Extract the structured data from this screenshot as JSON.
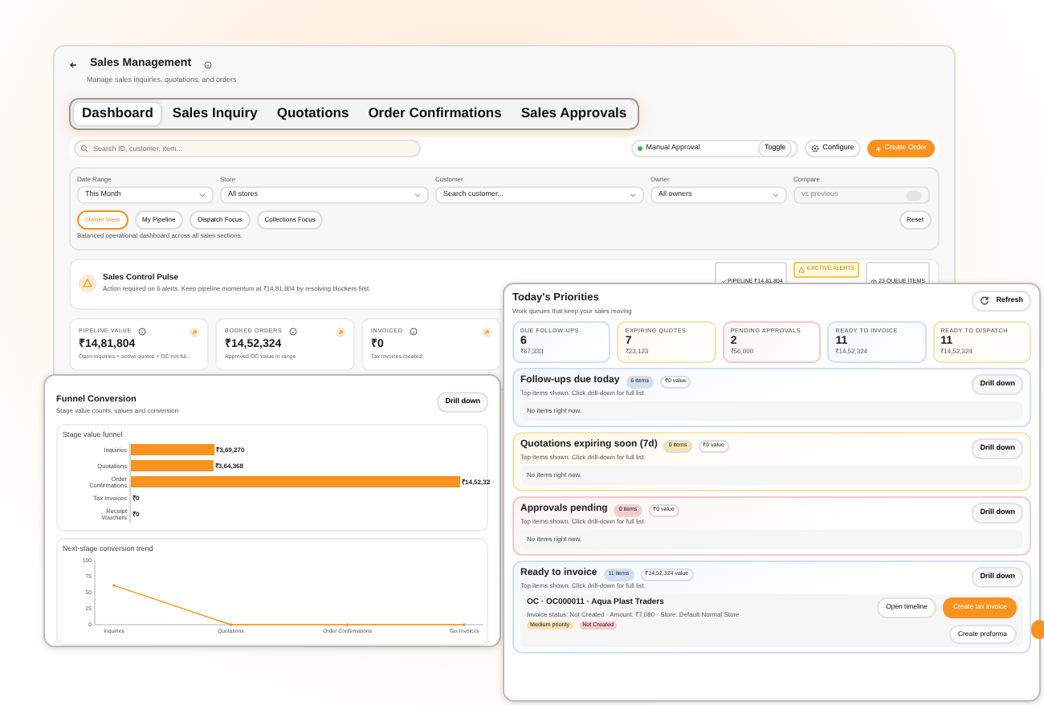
{
  "header": {
    "title": "Sales Management",
    "subtitle": "Manage sales inquiries, quotations, and orders"
  },
  "tabs": [
    {
      "label": "Dashboard",
      "selected": true
    },
    {
      "label": "Sales Inquiry",
      "selected": false
    },
    {
      "label": "Quotations",
      "selected": false
    },
    {
      "label": "Order Confirmations",
      "selected": false
    },
    {
      "label": "Sales Approvals",
      "selected": false
    }
  ],
  "toolbar": {
    "search": {
      "placeholder": "Search ID, customer, item..."
    },
    "approval": {
      "label": "Manual Approval",
      "on": true,
      "toggle": "Toggle"
    },
    "configure": "Configure",
    "create": "Create Order"
  },
  "filters": [
    {
      "label": "Date Range",
      "value": "This Month",
      "kind": "select"
    },
    {
      "label": "Store",
      "value": "All stores",
      "kind": "select"
    },
    {
      "label": "Customer",
      "value": "Search customer...",
      "kind": "select"
    },
    {
      "label": "Owner",
      "value": "All owners",
      "kind": "select"
    },
    {
      "label": "Compare",
      "value": "vs previous",
      "kind": "switch",
      "on": false
    }
  ],
  "views": [
    {
      "label": "Owner View",
      "selected": true
    },
    {
      "label": "My Pipeline",
      "selected": false
    },
    {
      "label": "Dispatch Focus",
      "selected": false
    },
    {
      "label": "Collections Focus",
      "selected": false
    }
  ],
  "views_caption": "Balanced operational dashboard across all sales sections.",
  "reset": "Reset",
  "pulse": {
    "title": "Sales Control Pulse",
    "message": "Action required on 6 alerts. Keep pipeline momentum at ₹14,81,804 by resolving blockers first.",
    "badges": [
      {
        "label": "PIPELINE ₹14,81,804",
        "kind": "trend"
      },
      {
        "label": "6 ACTIVE ALERTS",
        "kind": "alert"
      },
      {
        "label": "23 QUEUE ITEMS",
        "kind": "queue"
      }
    ]
  },
  "kpis": [
    {
      "label": "PIPELINE VALUE",
      "value": "₹14,81,804",
      "note": "Open inquiries + active quotes + OC not ful..."
    },
    {
      "label": "BOOKED ORDERS",
      "value": "₹14,52,324",
      "note": "Approved OC value in range"
    },
    {
      "label": "INVOICED",
      "value": "₹0",
      "note": "Tax invoices created"
    }
  ],
  "funnel": {
    "title": "Funnel Conversion",
    "subtitle": "Stage value counts, values and conversion",
    "drill": "Drill down",
    "bars": {
      "chart_data": {
        "type": "bar",
        "title": "Stage value funnel",
        "orientation": "horizontal",
        "categories": [
          "Inquiries",
          "Quotations",
          "Order Confirmations",
          "Tax Invoices",
          "Receipt Vouchers"
        ],
        "values": [
          369270,
          364368,
          1452324,
          0,
          0
        ],
        "value_labels": [
          "₹3,69,270",
          "₹3,64,368",
          "₹14,52,32",
          "₹0",
          "₹0"
        ]
      }
    },
    "trend": {
      "chart_data": {
        "type": "line",
        "title": "Next-stage conversion trend",
        "categories": [
          "Inquiries",
          "Quotations",
          "Order Confirmations",
          "Tax Invoices"
        ],
        "values": [
          61,
          0,
          0,
          0
        ],
        "ylim": [
          0,
          100
        ],
        "yticks": [
          0,
          25,
          50,
          75,
          100
        ]
      }
    }
  },
  "priorities": {
    "title": "Today's Priorities",
    "subtitle": "Work queues that keep your sales moving",
    "refresh": "Refresh",
    "tiles": [
      {
        "label": "DUE FOLLOW-UPS",
        "count": "6",
        "amount": "₹67,333",
        "color": "#cfe0f7"
      },
      {
        "label": "EXPIRING QUOTES",
        "count": "7",
        "amount": "₹23,123",
        "color": "#f6e3b0"
      },
      {
        "label": "PENDING APPROVALS",
        "count": "2",
        "amount": "₹56,000",
        "color": "#f6c9c9"
      },
      {
        "label": "READY TO INVOICE",
        "count": "11",
        "amount": "₹14,52,324",
        "color": "#cfe0f7"
      },
      {
        "label": "READY TO DISPATCH",
        "count": "11",
        "amount": "₹14,52,324",
        "color": "#f6e3b0"
      }
    ],
    "sections": [
      {
        "title": "Follow-ups due today",
        "count": "6 items",
        "value": "₹0 value",
        "color": "#cfe0f7",
        "hint": "Top items shown. Click drill-down for full list.",
        "drill": "Drill down",
        "empty": "No items right now."
      },
      {
        "title": "Quotations expiring soon (7d)",
        "count": "0 items",
        "value": "₹0 value",
        "color": "#f6e3b0",
        "hint": "Top items shown. Click drill-down for full list.",
        "drill": "Drill down",
        "empty": "No items right now."
      },
      {
        "title": "Approvals pending",
        "count": "0 items",
        "value": "₹0 value",
        "color": "#f6c9c9",
        "hint": "Top items shown. Click drill-down for full list.",
        "drill": "Drill down",
        "empty": "No items right now."
      },
      {
        "title": "Ready to invoice",
        "count": "11 items",
        "value": "₹14,52,324 value",
        "color": "#cfe0f7",
        "hint": "Top items shown. Click drill-down for full list.",
        "drill": "Drill down",
        "items": [
          {
            "title": "OC · OC000011 · Aqua Plast Traders",
            "meta": "Invoice status: Not Created · Amount: ₹7,080 · Store: Default Normal Store",
            "tags": [
              {
                "label": "Medium priority",
                "color": "#f6e3b0"
              },
              {
                "label": "Not Created",
                "color": "#f6c9c9"
              }
            ],
            "actions": [
              {
                "label": "Open timeline",
                "kind": "secondary"
              },
              {
                "label": "Create tax invoice",
                "kind": "primary"
              },
              {
                "label": "Create proforma",
                "kind": "secondary"
              }
            ]
          }
        ]
      }
    ]
  }
}
